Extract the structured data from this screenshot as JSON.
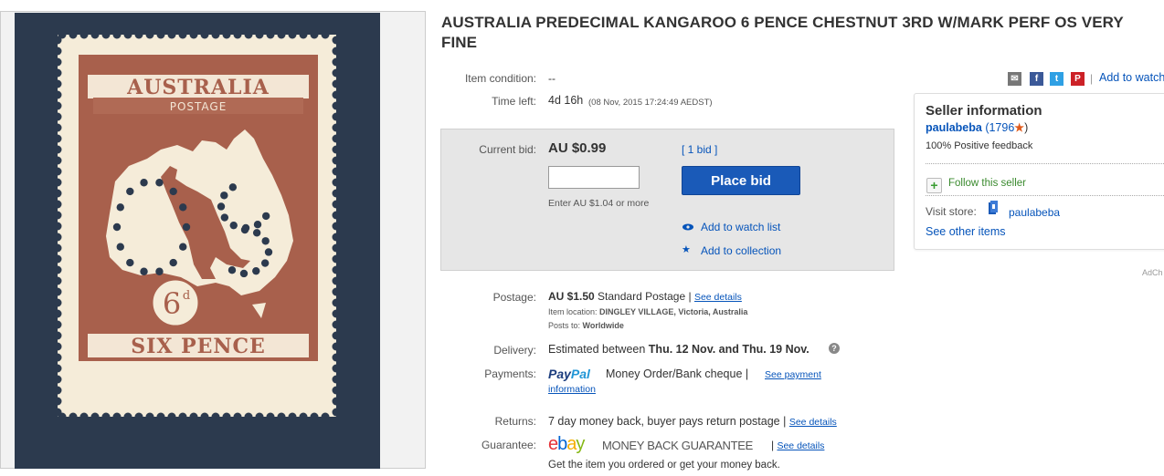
{
  "listing": {
    "title": "AUSTRALIA PREDECIMAL KANGAROO 6 PENCE CHESTNUT 3RD W/MARK PERF OS VERY FINE"
  },
  "stamp_image": {
    "country": "AUSTRALIA",
    "postage": "POSTAGE",
    "value": "6",
    "value_sup": "d",
    "denomination": "SIX PENCE"
  },
  "condition": {
    "label": "Item condition:",
    "value": "--"
  },
  "time_left": {
    "label": "Time left:",
    "value": "4d 16h",
    "end": "(08 Nov, 2015  17:24:49 AEDST)"
  },
  "share": {
    "add_to_watch": "Add to watch"
  },
  "bid": {
    "label": "Current bid:",
    "amount": "AU $0.99",
    "bids_link": "[ 1 bid ]",
    "input_value": "",
    "hint": "Enter AU $1.04 or more",
    "button": "Place bid",
    "watch_link": "Add to watch list",
    "collection_link": "Add to collection"
  },
  "postage": {
    "label": "Postage:",
    "amount": "AU $1.50",
    "method": "Standard Postage",
    "sep": "|",
    "details_link": "See details",
    "location_label": "Item location:",
    "location": "DINGLEY VILLAGE, Victoria, Australia",
    "posts_to_label": "Posts to:",
    "posts_to": "Worldwide"
  },
  "delivery": {
    "label": "Delivery:",
    "prefix": "Estimated between",
    "dates": "Thu. 12 Nov. and Thu. 19 Nov."
  },
  "payments": {
    "label": "Payments:",
    "paypal_1": "Pay",
    "paypal_2": "Pal",
    "text": "Money Order/Bank cheque",
    "sep": "|",
    "link_1": "See payment",
    "link_2": "information"
  },
  "returns": {
    "label": "Returns:",
    "text": "7 day money back, buyer pays return postage",
    "sep": "|",
    "link": "See details"
  },
  "guarantee": {
    "label": "Guarantee:",
    "ebay_e": "e",
    "ebay_b": "b",
    "ebay_a": "a",
    "ebay_y": "y",
    "text": "MONEY BACK GUARANTEE",
    "sep": "|",
    "link": "See details",
    "note": "Get the item you ordered or get your money back."
  },
  "seller": {
    "heading": "Seller information",
    "name": "paulabeba",
    "score": "(1796",
    "score_end": ")",
    "feedback": "100% Positive feedback",
    "follow": "Follow this seller",
    "visit_label": "Visit store:",
    "store": "paulabeba",
    "other_items": "See other items"
  },
  "ad_label": "AdCh",
  "colors": {
    "link": "#0654ba",
    "button": "#1a5ab8",
    "stamp": "#a8604c",
    "paper": "#f5ecd9",
    "star": "#e05a1a"
  }
}
